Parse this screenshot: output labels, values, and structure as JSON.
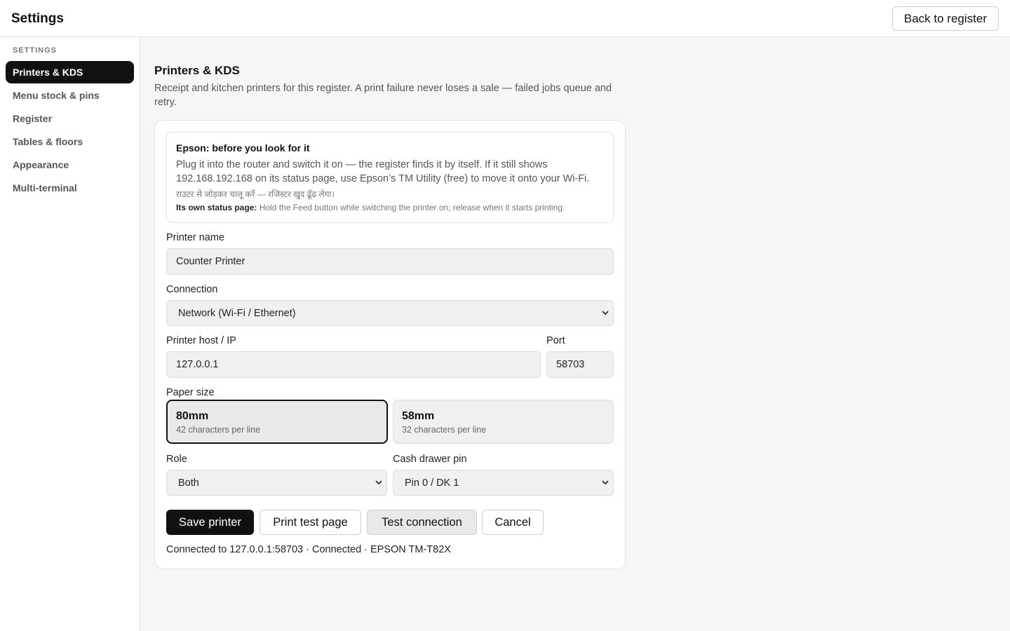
{
  "header": {
    "title": "Settings",
    "back_label": "Back to register"
  },
  "sidebar": {
    "section_label": "SETTINGS",
    "items": [
      {
        "label": "Printers & KDS",
        "active": true
      },
      {
        "label": "Menu stock & pins",
        "active": false
      },
      {
        "label": "Register",
        "active": false
      },
      {
        "label": "Tables & floors",
        "active": false
      },
      {
        "label": "Appearance",
        "active": false
      },
      {
        "label": "Multi-terminal",
        "active": false
      }
    ]
  },
  "main": {
    "title": "Printers & KDS",
    "description": "Receipt and kitchen printers for this register. A print failure never loses a sale — failed jobs queue and retry.",
    "tip": {
      "title": "Epson: before you look for it",
      "body": "Plug it into the router and switch it on — the register finds it by itself. If it still shows 192.168.192.168 on its status page, use Epson’s TM Utility (free) to move it onto your Wi-Fi.",
      "hindi": "राउटर से जोड़कर चालू करें — रजिस्टर खुद ढूँढ लेगा।",
      "status_label": "Its own status page:",
      "status_text": " Hold the Feed button while switching the printer on; release when it starts printing."
    },
    "form": {
      "printer_name_label": "Printer name",
      "printer_name_value": "Counter Printer",
      "connection_label": "Connection",
      "connection_value": "Network (Wi-Fi / Ethernet)",
      "host_label": "Printer host / IP",
      "host_value": "127.0.0.1",
      "port_label": "Port",
      "port_value": "58703",
      "paper_size_label": "Paper size",
      "paper_sizes": [
        {
          "name": "80mm",
          "sub": "42 characters per line",
          "selected": true
        },
        {
          "name": "58mm",
          "sub": "32 characters per line",
          "selected": false
        }
      ],
      "role_label": "Role",
      "role_value": "Both",
      "drawer_label": "Cash drawer pin",
      "drawer_value": "Pin 0 / DK 1"
    },
    "actions": {
      "save": "Save printer",
      "print_test": "Print test page",
      "test_connection": "Test connection",
      "cancel": "Cancel"
    },
    "status": "Connected to 127.0.0.1:58703 · Connected · EPSON TM-T82X"
  },
  "colors": {
    "accent": "#111111",
    "background": "#f6f6f6",
    "surface": "#ffffff",
    "input_bg": "#f0f0f0"
  }
}
